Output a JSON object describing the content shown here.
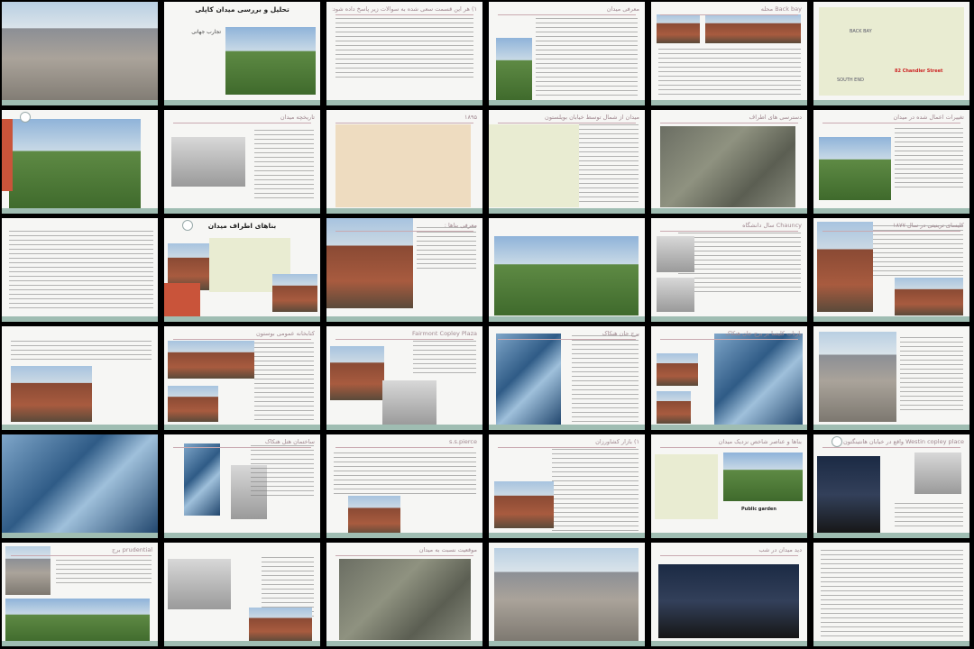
{
  "window": {
    "title": ""
  },
  "slides": [
    {
      "id": "s1",
      "title": "",
      "bold": false
    },
    {
      "id": "s2",
      "title": "تحلیل و بررسی میدان کاپلی",
      "subtitle": "تجارب جهانی",
      "bold": true
    },
    {
      "id": "s3",
      "title": "۱) هر این قسمت سعی شده به سوالات زیر پاسخ داده شود:",
      "bold": false
    },
    {
      "id": "s4",
      "title": "معرفی میدان",
      "bold": false
    },
    {
      "id": "s5",
      "title": "Back bay محله",
      "bold": false
    },
    {
      "id": "s6",
      "title": "",
      "bold": false
    },
    {
      "id": "s7",
      "title": "",
      "bold": false
    },
    {
      "id": "s8",
      "title": "تاریخچه میدان",
      "bold": false
    },
    {
      "id": "s9",
      "title": "۱۸۹۵",
      "bold": false
    },
    {
      "id": "s10",
      "title": "میدان از شمال توسط خیابان بویلستون",
      "bold": false
    },
    {
      "id": "s11",
      "title": "دسترسی های اطراف",
      "bold": false
    },
    {
      "id": "s12",
      "title": "تغییرات اعمال شده در میدان",
      "bold": false
    },
    {
      "id": "s13",
      "title": "",
      "bold": false
    },
    {
      "id": "s14",
      "title": "بناهای اطراف میدان",
      "bold": true
    },
    {
      "id": "s15",
      "title": "معرفی بناها :",
      "bold": false
    },
    {
      "id": "s16",
      "title": "",
      "bold": false
    },
    {
      "id": "s17",
      "title": "Chauncy سال دانشگاه",
      "bold": false
    },
    {
      "id": "s18",
      "title": "کلیسای ترینیتی در سال ۱۸۷۷",
      "bold": false
    },
    {
      "id": "s19",
      "title": "",
      "bold": false
    },
    {
      "id": "s20",
      "title": "کتابخانه عمومی بوستون",
      "bold": false
    },
    {
      "id": "s21",
      "title": "Fairmont Copley Plaza",
      "bold": false
    },
    {
      "id": "s22",
      "title": "برج جان هنکاک",
      "bold": false
    },
    {
      "id": "s23",
      "title": "بازتاب کلیسا بر برج جان هنکاک",
      "bold": false
    },
    {
      "id": "s24",
      "title": "",
      "bold": false
    },
    {
      "id": "s25",
      "title": "",
      "bold": false
    },
    {
      "id": "s26",
      "title": "ساختمان هتل هنکاک",
      "bold": false
    },
    {
      "id": "s27",
      "title": "s.s.pierce",
      "bold": false
    },
    {
      "id": "s28",
      "title": "۱) بازار کشاورزان",
      "bold": false
    },
    {
      "id": "s29",
      "title": "بناها و عناصر شاخص نزدیک میدان",
      "bold": false
    },
    {
      "id": "s30",
      "title": "Westin copley place واقع در خیابان هانتینگتون",
      "bold": false
    },
    {
      "id": "s31",
      "title": "prudential برج",
      "bold": false
    },
    {
      "id": "s32",
      "title": "",
      "bold": false
    },
    {
      "id": "s33",
      "title": "موقعیت نسبت به میدان",
      "bold": false
    },
    {
      "id": "s34",
      "title": "",
      "bold": false
    },
    {
      "id": "s35",
      "title": "دید میدان در شب",
      "bold": false
    },
    {
      "id": "s36",
      "title": "",
      "bold": false
    }
  ],
  "labels": {
    "slide5_caption": "Back bay",
    "slide6_map_label": "BACK BAY",
    "slide6_map_label2": "SOUTH END",
    "slide6_address": "82 Chandler Street",
    "slide29_caption": "Public garden"
  }
}
